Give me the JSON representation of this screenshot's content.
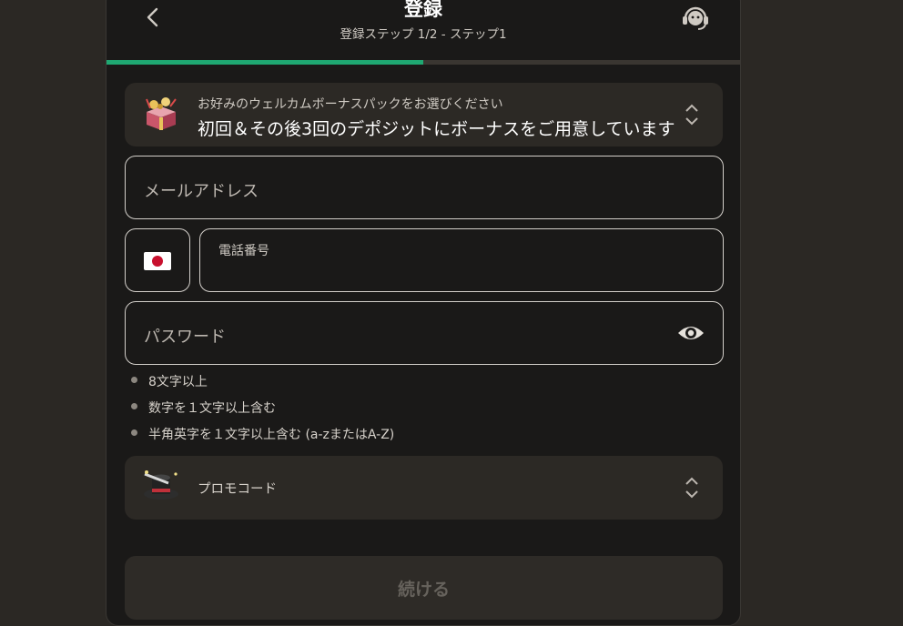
{
  "header": {
    "title": "登録",
    "subtitle": "登録ステップ 1/2 - ステップ1",
    "progress": 0.5
  },
  "bonus": {
    "label": "お好みのウェルカムボーナスパックをお選びください",
    "value": "初回＆その後3回のデポジットにボーナスをご用意しています"
  },
  "form": {
    "email_placeholder": "メールアドレス",
    "phone_label": "電話番号",
    "phone_country": "jp-flag-icon",
    "password_placeholder": "パスワード"
  },
  "password_rules": [
    "8文字以上",
    "数字を１文字以上含む",
    "半角英字を１文字以上含む (a-zまたはA-Z)"
  ],
  "promo": {
    "label": "プロモコード"
  },
  "continue": {
    "label": "続ける"
  },
  "icons": {
    "back": "chevron-left-icon",
    "support": "headset-icon",
    "bonus": "gift-box-icon",
    "selector": "chevron-up-down-icon",
    "eye": "eye-icon",
    "promo": "magic-hat-icon"
  },
  "colors": {
    "accent": "#1fa872",
    "background": "#2b2824",
    "panel": "#1a1918",
    "card": "#2c2925"
  }
}
